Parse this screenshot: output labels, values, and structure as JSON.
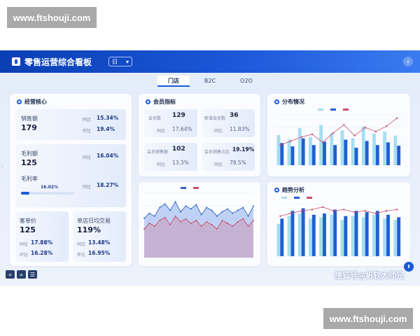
{
  "watermarks": {
    "top": "www.ftshouji.com",
    "bottom": "www.ftshouji.com"
  },
  "header": {
    "title": "零售运营综合看板",
    "period_select": "日",
    "chevron": "▾",
    "download_glyph": "⤓"
  },
  "tabs": [
    {
      "label": "门店",
      "active": true
    },
    {
      "label": "B2C",
      "active": false
    },
    {
      "label": "O2O",
      "active": false
    }
  ],
  "core": {
    "title": "经营核心",
    "sales": {
      "label": "销售额",
      "value": "179",
      "tongbi_label": "同比",
      "tongbi": "15.34%",
      "huanbi_label": "环比",
      "huanbi": "19.4%"
    },
    "gross": {
      "label": "毛利额",
      "value": "125",
      "tongbi_label": "同比",
      "tongbi": "16.04%"
    },
    "margin": {
      "label": "毛利率",
      "progress_label": "16.02%",
      "progress": 0.16,
      "tongbi_label": "同比",
      "tongbi": "18.27%"
    },
    "unit_price": {
      "label": "客单价",
      "value": "125",
      "tongbi_label": "同比",
      "tongbi": "17.88%",
      "huanbi_label": "环比",
      "huanbi": "16.28%"
    },
    "daily_avg": {
      "label": "单店日均交易",
      "value": "119%",
      "tongbi_label": "同比",
      "tongbi": "13.48%",
      "huanbi_label": "环比",
      "huanbi": "16.95%"
    }
  },
  "member": {
    "title": "会员指标",
    "count": {
      "label": "会员数",
      "value": "129",
      "tongbi_label": "同比",
      "tongbi": "17.64%"
    },
    "new": {
      "label": "新增会员数",
      "value": "36",
      "tongbi_label": "同比",
      "tongbi": "11.83%"
    },
    "sales": {
      "label": "会员销售额",
      "value": "102",
      "tongbi_label": "同比",
      "tongbi": "13.3%"
    },
    "share": {
      "label": "会员销售占比",
      "value": "19.19%",
      "tongbi_label": "同比",
      "tongbi": "78.5%"
    }
  },
  "distribution": {
    "title": "分布情况"
  },
  "trend": {
    "title": "趋势分析"
  },
  "footer": {
    "sohu": "搜狐号@帆软大师兄",
    "nav_prev": "«",
    "nav_next": "»",
    "nav_list": "☰",
    "fab_glyph": "⬆",
    "edge_glyph": "‹"
  },
  "colors": {
    "brand": "#1a5ad8",
    "light_bar": "#a6dff0",
    "dark_bar": "#1f5fd2",
    "red_line": "#c9506a",
    "blue_line": "#2f63c8"
  },
  "chart_data": [
    {
      "type": "bar",
      "panel": "分布情况",
      "series": [
        {
          "values": [
            45,
            38,
            55,
            42,
            60,
            48,
            52,
            40,
            58,
            47,
            50,
            44
          ]
        },
        {
          "values": [
            33,
            28,
            40,
            30,
            35,
            30,
            38,
            26,
            36,
            30,
            34,
            29
          ]
        }
      ],
      "line": [
        30,
        36,
        42,
        46,
        34,
        48,
        60,
        44,
        56,
        50,
        58,
        70
      ]
    },
    {
      "type": "area",
      "panel": "middle",
      "series": [
        {
          "values": [
            55,
            62,
            58,
            70,
            75,
            66,
            78,
            64,
            72,
            68,
            74,
            60,
            70,
            66,
            58,
            64,
            68,
            62,
            66,
            70,
            58,
            72
          ]
        },
        {
          "values": [
            40,
            48,
            44,
            52,
            56,
            46,
            58,
            50,
            54,
            48,
            52,
            44,
            50,
            46,
            40,
            52,
            48,
            44,
            50,
            54,
            44,
            52
          ]
        }
      ]
    },
    {
      "type": "bar",
      "panel": "趋势分析",
      "series": [
        {
          "values": [
            50,
            62,
            66,
            58,
            60,
            64,
            56,
            62,
            60,
            64,
            58,
            56
          ]
        },
        {
          "values": [
            58,
            70,
            74,
            64,
            66,
            72,
            62,
            70,
            68,
            70,
            64,
            60
          ]
        }
      ],
      "line": [
        62,
        66,
        70,
        72,
        76,
        70,
        72,
        68,
        70,
        66,
        70,
        72
      ]
    }
  ]
}
